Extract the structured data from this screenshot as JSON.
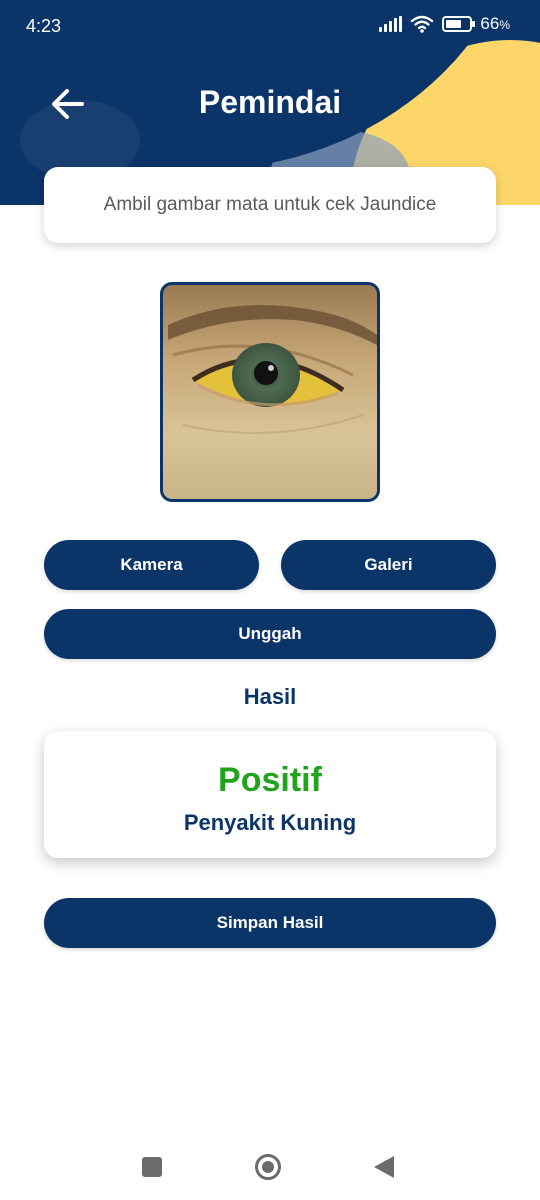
{
  "status_bar": {
    "time": "4:23",
    "battery": "66",
    "battery_unit": "%",
    "battery_level": 0.66
  },
  "app_bar": {
    "title": "Pemindai",
    "back_icon": "arrow-left-icon"
  },
  "instruction": {
    "text": "Ambil gambar mata untuk cek Jaundice"
  },
  "preview": {
    "image": "eye-photo-yellow-sclera"
  },
  "actions": {
    "camera_label": "Kamera",
    "gallery_label": "Galeri",
    "upload_label": "Unggah",
    "save_label": "Simpan Hasil"
  },
  "result": {
    "heading": "Hasil",
    "status": "Positif",
    "diagnosis": "Penyakit Kuning"
  },
  "navigation": {
    "recent_icon": "square-icon",
    "home_icon": "circle-icon",
    "back_icon": "triangle-back-icon"
  },
  "colors": {
    "primary": "#0b3469",
    "accent": "#fdd66a",
    "positive": "#21a31e"
  }
}
